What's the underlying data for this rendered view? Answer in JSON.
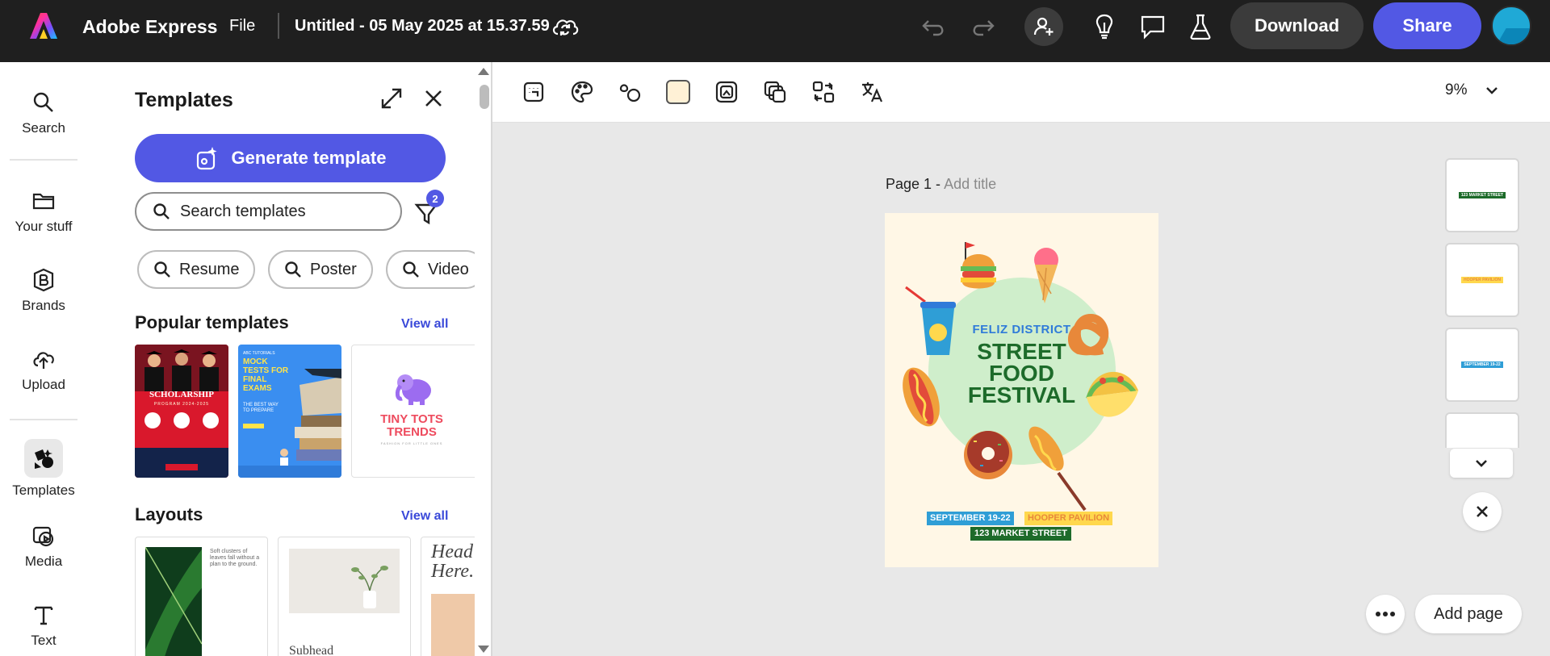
{
  "app": {
    "brand": "Adobe Express",
    "file_menu": "File",
    "doc_title": "Untitled - 05 May 2025 at 15.37.59",
    "download_label": "Download",
    "share_label": "Share"
  },
  "rail": {
    "items": [
      {
        "label": "Search",
        "icon": "search-icon"
      },
      {
        "label": "Your stuff",
        "icon": "folder-icon"
      },
      {
        "label": "Brands",
        "icon": "brand-icon"
      },
      {
        "label": "Upload",
        "icon": "upload-cloud-icon"
      },
      {
        "label": "Templates",
        "icon": "templates-icon",
        "active": true
      },
      {
        "label": "Media",
        "icon": "media-icon"
      },
      {
        "label": "Text",
        "icon": "text-icon"
      }
    ]
  },
  "panel": {
    "title": "Templates",
    "generate_label": "Generate template",
    "search_placeholder": "Search templates",
    "filter_count": "2",
    "chips": [
      "Resume",
      "Poster",
      "Video"
    ],
    "popular_title": "Popular templates",
    "layouts_title": "Layouts",
    "view_all": "View all",
    "popular": [
      {
        "title": "SCHOLARSHIP",
        "subtitle": "PROGRAM 2024-2025"
      },
      {
        "kicker": "ABC TUTORIALS",
        "title": "MOCK TESTS FOR FINAL EXAMS",
        "subtitle": "THE BEST WAY TO PREPARE"
      },
      {
        "title": "TINY TOTS TRENDS",
        "subtitle": "FASHION FOR LITTLE ONES"
      }
    ],
    "layouts": [
      {
        "text": "Soft clusters of leaves fall without a plan to the ground."
      },
      {
        "text": "Subhead"
      },
      {
        "text": "Head Here."
      }
    ]
  },
  "canvas": {
    "zoom": "9%",
    "page_label": "Page 1 - ",
    "add_title": "Add title",
    "poster": {
      "kicker": "FELIZ DISTRICT",
      "line1": "STREET",
      "line2": "FOOD",
      "line3": "FESTIVAL",
      "date": "SEPTEMBER 19-22",
      "venue": "HOOPER PAVILION",
      "address": "123 MARKET STREET"
    },
    "thumbs": [
      "123 MARKET STREET",
      "HOOPER PAVILION",
      "SEPTEMBER 19-22"
    ],
    "add_page_label": "Add page"
  },
  "colors": {
    "accent": "#5258e4",
    "topbar": "#1f1f1f",
    "poster_bg": "#fff7e6",
    "poster_green": "#1d6b2a",
    "poster_blue": "#2f9ed6",
    "poster_yellow": "#ffd84d"
  }
}
